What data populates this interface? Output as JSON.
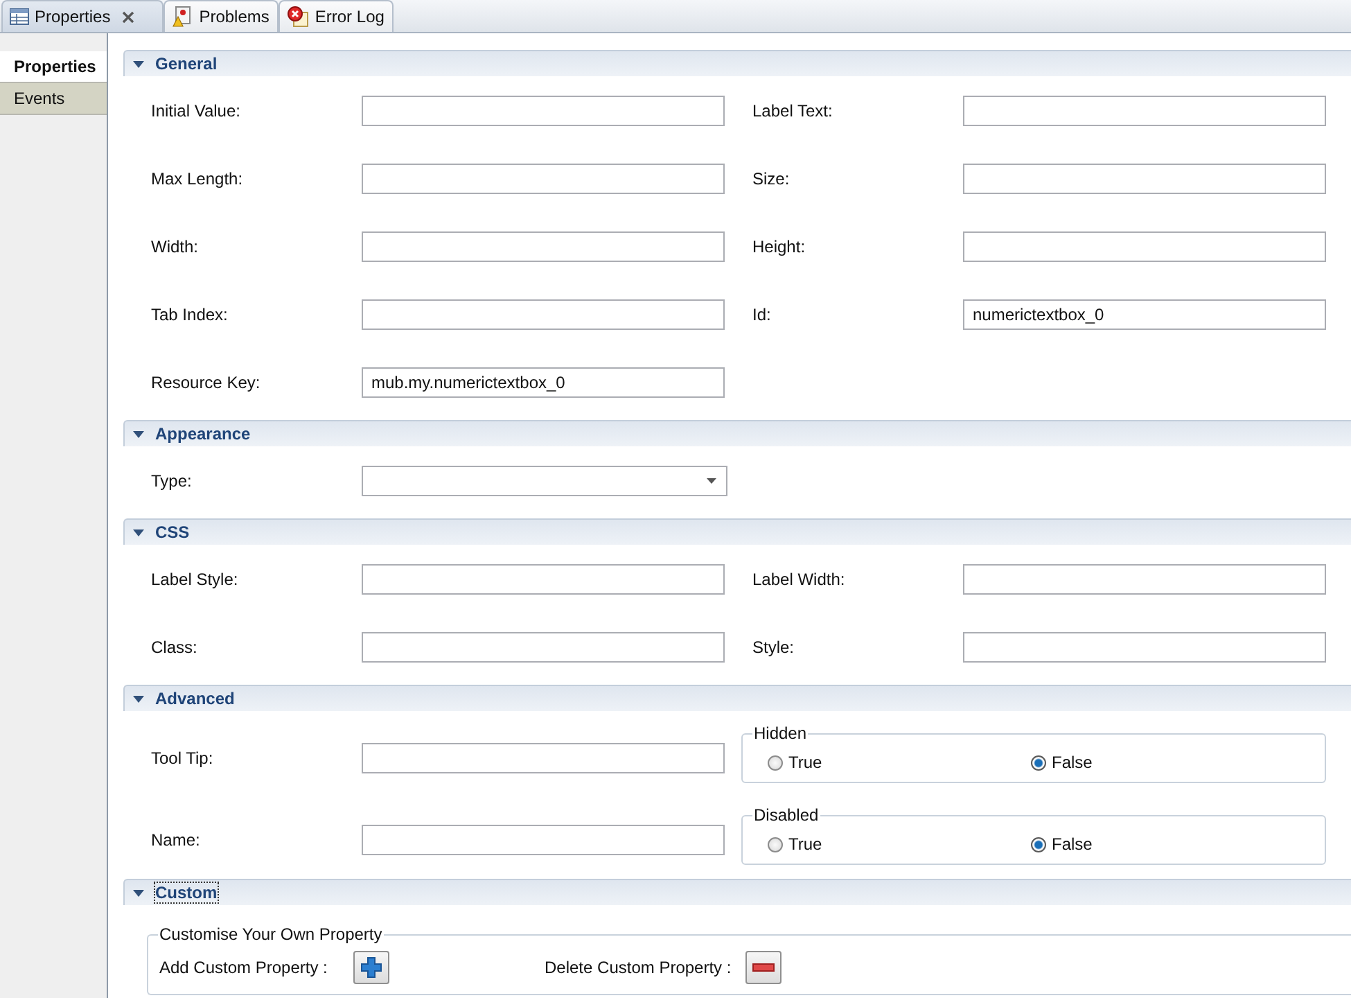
{
  "view_tabs": [
    {
      "label": "Properties",
      "closable": true,
      "selected": true
    },
    {
      "label": "Problems",
      "closable": false,
      "selected": false
    },
    {
      "label": "Error Log",
      "closable": false,
      "selected": false
    }
  ],
  "side_tabs": [
    {
      "label": "Properties",
      "selected": true
    },
    {
      "label": "Events",
      "selected": false
    }
  ],
  "sections": [
    {
      "title": "General",
      "expanded": true,
      "focused": false,
      "rows": [
        [
          {
            "kind": "text",
            "label": "Initial Value:"
          },
          {
            "kind": "text",
            "label": "Label Text:"
          }
        ],
        [
          {
            "kind": "text",
            "label": "Max Length:"
          },
          {
            "kind": "text",
            "label": "Size:"
          }
        ],
        [
          {
            "kind": "text",
            "label": "Width:"
          },
          {
            "kind": "text",
            "label": "Height:"
          }
        ],
        [
          {
            "kind": "text",
            "label": "Tab Index:"
          },
          {
            "kind": "text",
            "label": "Id:",
            "value": "numerictextbox_0"
          }
        ],
        [
          {
            "kind": "text",
            "label": "Resource Key:",
            "value": "mub.my.numerictextbox_0"
          }
        ]
      ]
    },
    {
      "title": "Appearance",
      "expanded": true,
      "focused": false,
      "rows": [
        [
          {
            "kind": "select",
            "label": "Type:"
          }
        ]
      ]
    },
    {
      "title": "CSS",
      "expanded": true,
      "focused": false,
      "rows": [
        [
          {
            "kind": "text",
            "label": "Label Style:"
          },
          {
            "kind": "text",
            "label": "Label Width:"
          }
        ],
        [
          {
            "kind": "text",
            "label": "Class:"
          },
          {
            "kind": "text",
            "label": "Style:"
          }
        ]
      ]
    },
    {
      "title": "Advanced",
      "expanded": true,
      "focused": false,
      "rows": [
        [
          {
            "kind": "text",
            "label": "Tool Tip:"
          },
          {
            "kind": "radio",
            "title": "Hidden",
            "options": [
              {
                "label": "True",
                "selected": false
              },
              {
                "label": "False",
                "selected": true
              }
            ]
          }
        ],
        [
          {
            "kind": "text",
            "label": "Name:"
          },
          {
            "kind": "radio",
            "title": "Disabled",
            "options": [
              {
                "label": "True",
                "selected": false
              },
              {
                "label": "False",
                "selected": true
              }
            ]
          }
        ]
      ]
    },
    {
      "title": "Custom",
      "expanded": true,
      "focused": true,
      "group": {
        "title": "Customise Your Own Property",
        "add_label": "Add Custom Property :",
        "delete_label": "Delete Custom Property :"
      }
    }
  ]
}
